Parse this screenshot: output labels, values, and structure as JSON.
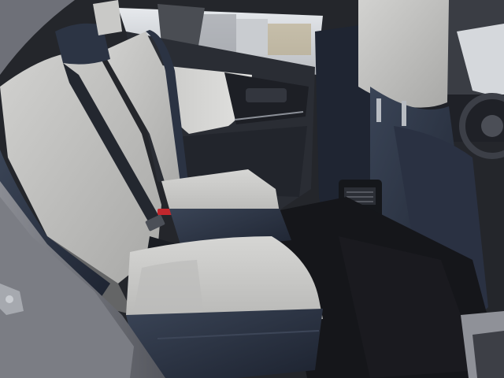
{
  "scene": {
    "kind": "photo",
    "subject": "car-rear-seat-interior",
    "colors": {
      "seat_light": "#c9c9c7",
      "seat_light_shade": "#a9a9a8",
      "leather_navy": "#2c3444",
      "leather_navy_dark": "#1d2330",
      "door_panel_light": "#d3d3d1",
      "door_trim_dark": "#252830",
      "floor_carpet": "#17181c",
      "door_frame": "#6e7078",
      "window_sky": "#d9dde2",
      "buckle_red": "#c2272d"
    },
    "icons": [
      "seatbelt-icon",
      "headrest-icon",
      "steering-wheel-icon",
      "air-vent-icon"
    ]
  }
}
